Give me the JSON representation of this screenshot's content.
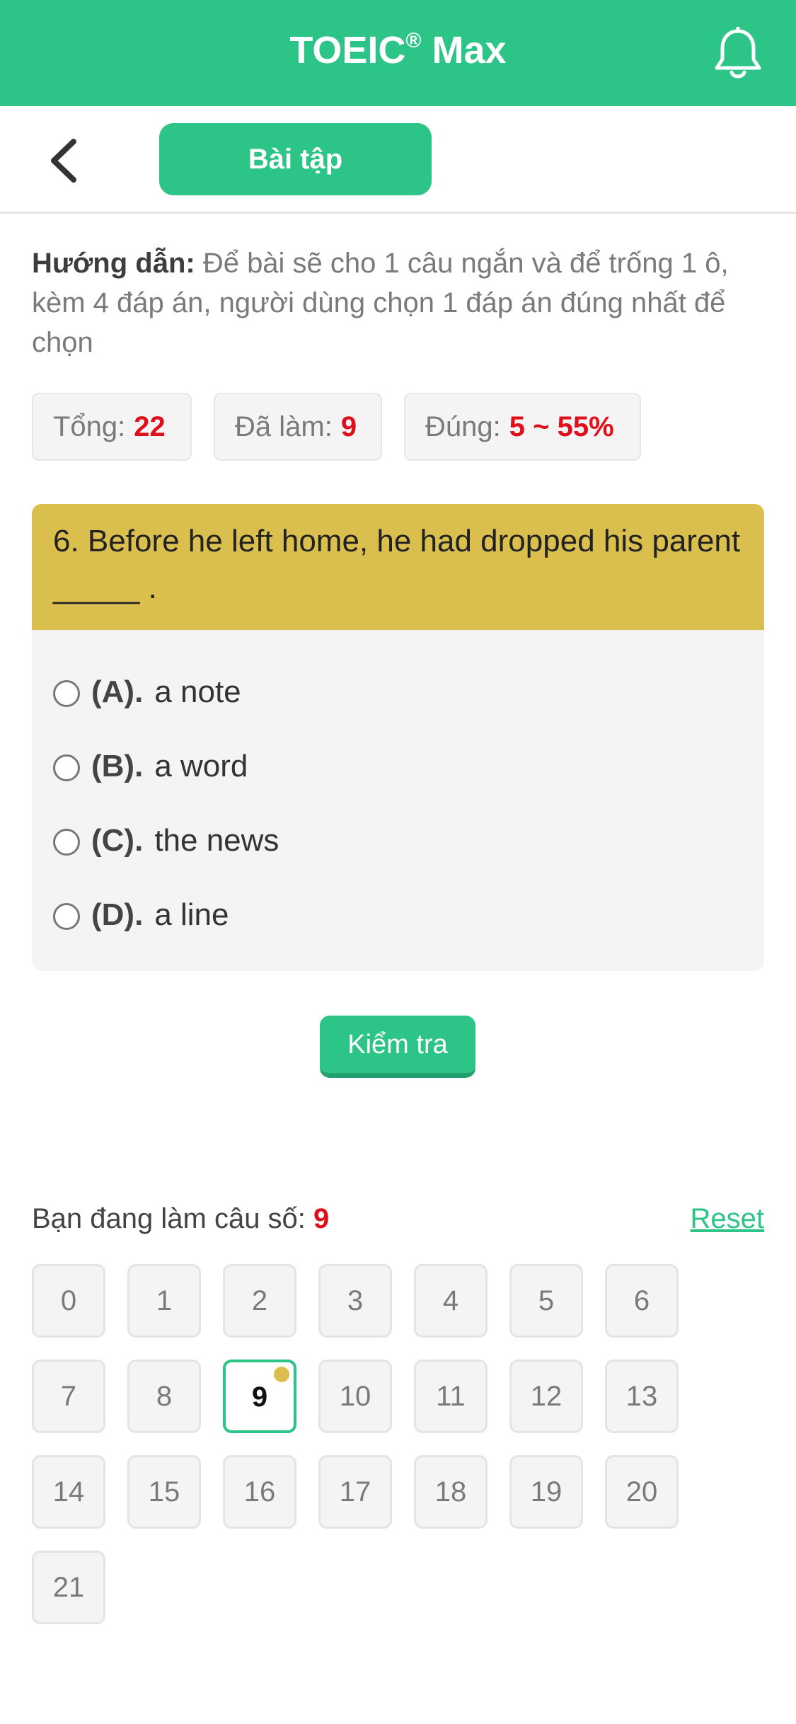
{
  "header": {
    "title": "TOEIC",
    "title_reg": "®",
    "title_suffix": " Max",
    "icon": "bell-icon"
  },
  "subheader": {
    "back_icon": "chevron-left-icon",
    "tab_label": "Bài tập"
  },
  "guide": {
    "label": "Hướng dẫn:",
    "text": " Để bài sẽ cho 1 câu ngắn và để trống 1 ô, kèm 4 đáp án, người dùng chọn 1 đáp án đúng nhất để chọn"
  },
  "stats": {
    "total_label": "Tổng:",
    "total_value": "22",
    "done_label": "Đã làm:",
    "done_value": "9",
    "correct_label": "Đúng:",
    "correct_value": "5 ~ 55%"
  },
  "question": {
    "text": "6. Before he left home, he had dropped his parent _____ .",
    "options": [
      {
        "letter": "(A).",
        "text": "a note"
      },
      {
        "letter": "(B).",
        "text": "a word"
      },
      {
        "letter": "(C).",
        "text": "the news"
      },
      {
        "letter": "(D).",
        "text": "a line"
      }
    ]
  },
  "check_button": "Kiểm tra",
  "navigator": {
    "current_label": "Bạn đang làm câu số:",
    "current_value": "9",
    "reset_label": "Reset",
    "active_index": 9,
    "numbers": [
      "0",
      "1",
      "2",
      "3",
      "4",
      "5",
      "6",
      "7",
      "8",
      "9",
      "10",
      "11",
      "12",
      "13",
      "14",
      "15",
      "16",
      "17",
      "18",
      "19",
      "20",
      "21"
    ]
  },
  "colors": {
    "brand": "#2dc487",
    "question_header": "#dbbf4e",
    "highlight": "#e0101b"
  }
}
